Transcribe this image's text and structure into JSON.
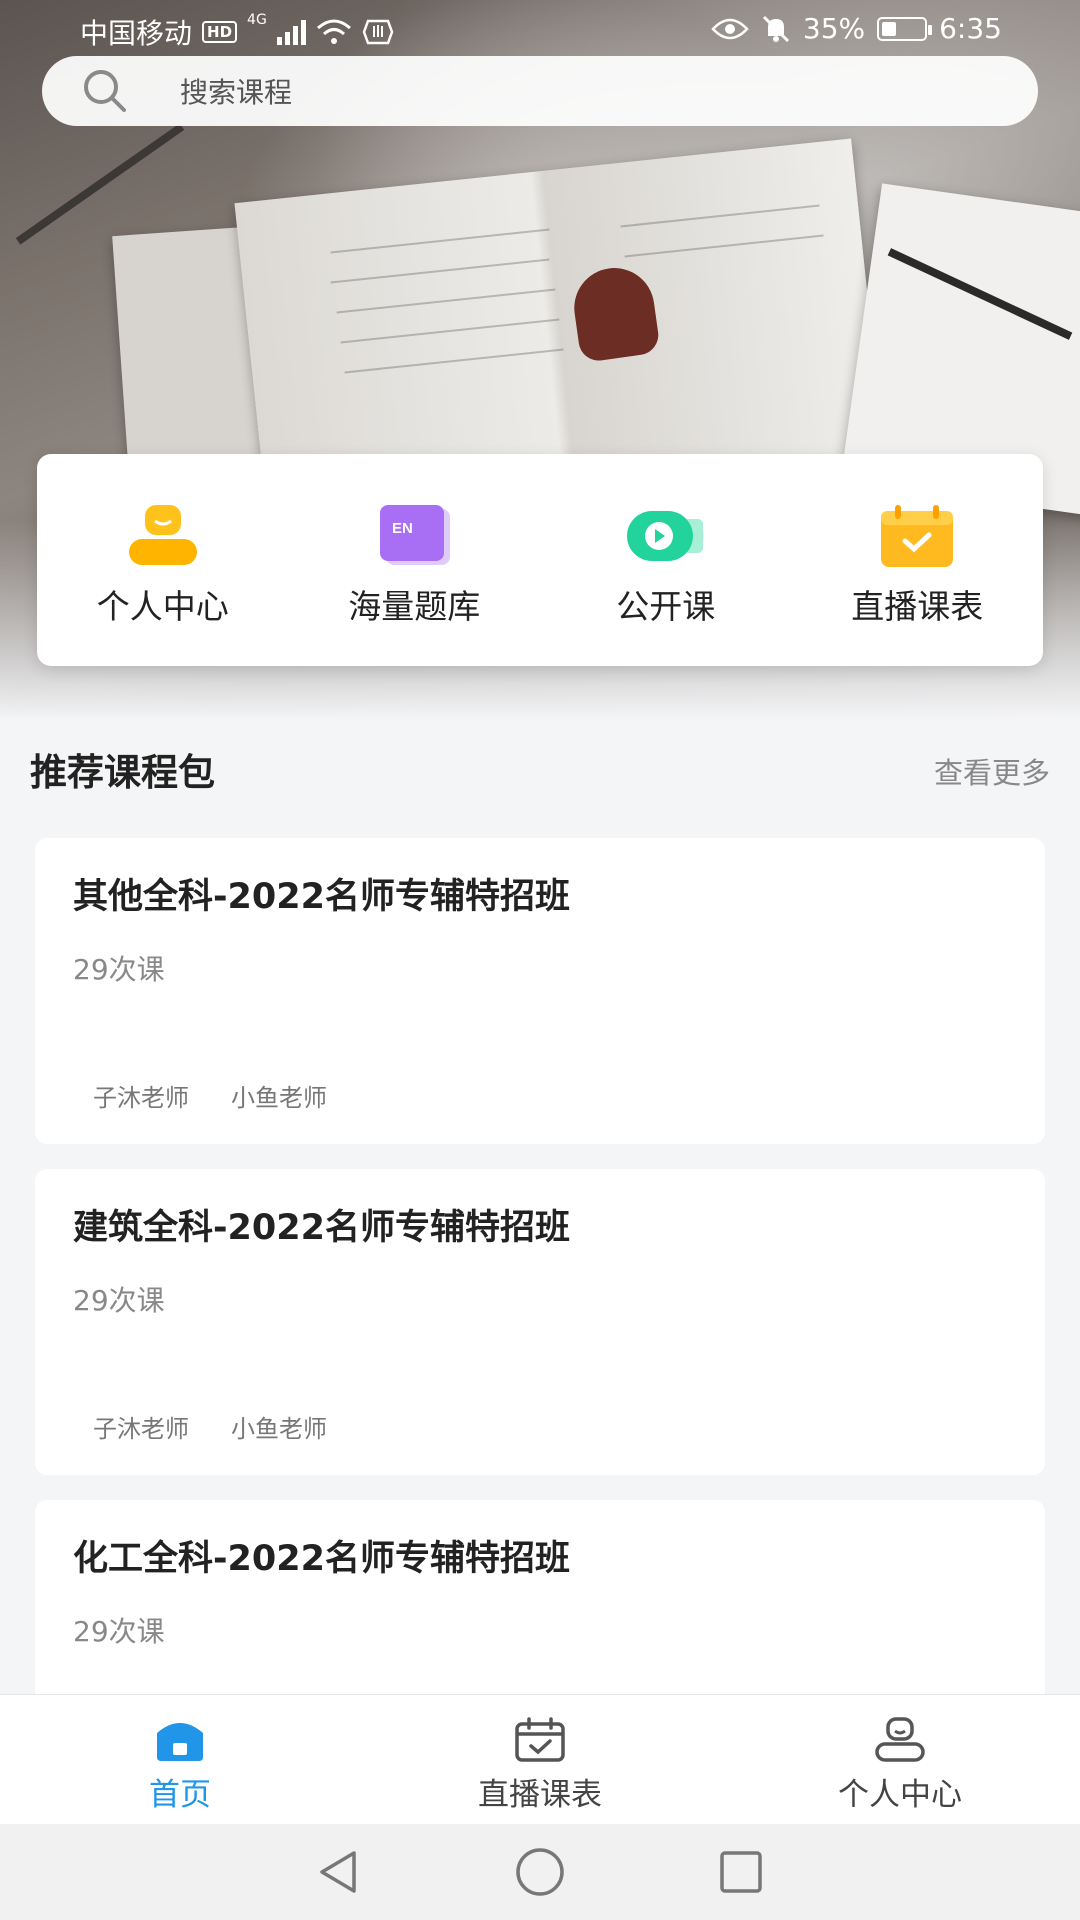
{
  "status_bar": {
    "carrier": "中国移动",
    "network": "4G",
    "hd": "HD",
    "battery": "35%",
    "battery_level": 0.35,
    "time": "6:35"
  },
  "search": {
    "placeholder": "搜索课程"
  },
  "quick_menu": [
    {
      "label": "个人中心",
      "icon": "user-icon",
      "color": "#ffc21a"
    },
    {
      "label": "海量题库",
      "icon": "question-bank-icon",
      "color": "#a86ff5"
    },
    {
      "label": "公开课",
      "icon": "open-class-video-icon",
      "color": "#22d39b"
    },
    {
      "label": "直播课表",
      "icon": "calendar-icon",
      "color": "#ffba1f"
    }
  ],
  "section": {
    "title": "推荐课程包",
    "more": "查看更多"
  },
  "courses": [
    {
      "title": "其他全科-2022名师专辅特招班",
      "count": "29次课",
      "teachers": [
        "子沐老师",
        "小鱼老师"
      ]
    },
    {
      "title": "建筑全科-2022名师专辅特招班",
      "count": "29次课",
      "teachers": [
        "子沐老师",
        "小鱼老师"
      ]
    },
    {
      "title": "化工全科-2022名师专辅特招班",
      "count": "29次课",
      "teachers": []
    }
  ],
  "tabbar": [
    {
      "label": "首页",
      "icon": "home-icon",
      "active": true
    },
    {
      "label": "直播课表",
      "icon": "calendar-check-icon",
      "active": false
    },
    {
      "label": "个人中心",
      "icon": "profile-icon",
      "active": false
    }
  ],
  "colors": {
    "accent": "#2196e8",
    "text_secondary": "#888888"
  }
}
